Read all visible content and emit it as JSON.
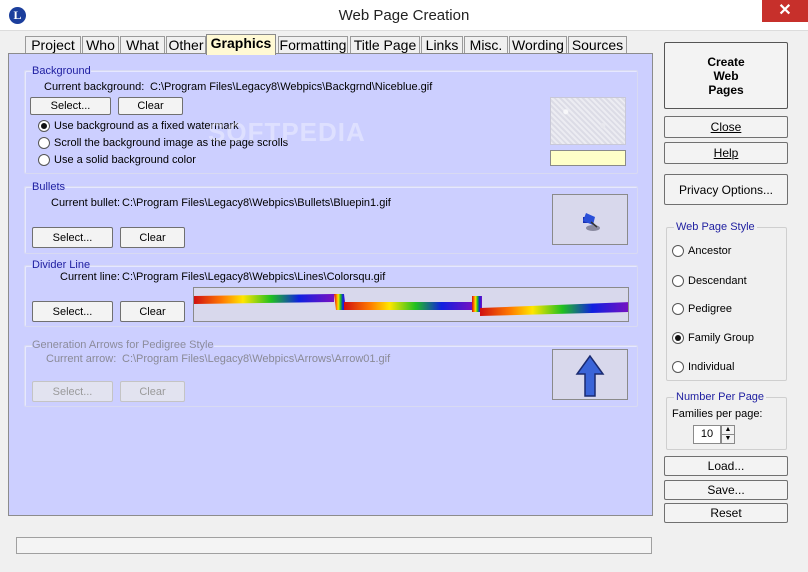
{
  "window": {
    "title": "Web Page Creation",
    "close_glyph": "✕",
    "app_icon_letter": "L"
  },
  "tabs": [
    "Project",
    "Who",
    "What",
    "Other",
    "Graphics",
    "Formatting",
    "Title Page",
    "Links",
    "Misc.",
    "Wording",
    "Sources"
  ],
  "active_tab": "Graphics",
  "background": {
    "label": "Background",
    "current_caption": "Current background:",
    "path": "C:\\Program Files\\Legacy8\\Webpics\\Backgrnd\\Niceblue.gif",
    "select_label": "Select...",
    "clear_label": "Clear",
    "options": [
      {
        "label": "Use background as a fixed watermark",
        "checked": true
      },
      {
        "label": "Scroll the background image as the page scrolls",
        "checked": false
      },
      {
        "label": "Use a solid background color",
        "checked": false
      }
    ],
    "swatch_color": "#ffffc8"
  },
  "bullets": {
    "label": "Bullets",
    "current_caption": "Current bullet:",
    "path": "C:\\Program Files\\Legacy8\\Webpics\\Bullets\\Bluepin1.gif",
    "select_label": "Select...",
    "clear_label": "Clear",
    "preview_icon": "pushpin-icon"
  },
  "divider": {
    "label": "Divider Line",
    "current_caption": "Current line:",
    "path": "C:\\Program Files\\Legacy8\\Webpics\\Lines\\Colorsqu.gif",
    "select_label": "Select...",
    "clear_label": "Clear"
  },
  "arrows": {
    "label": "Generation Arrows for Pedigree Style",
    "current_caption": "Current arrow:",
    "path": "C:\\Program Files\\Legacy8\\Webpics\\Arrows\\Arrow01.gif",
    "select_label": "Select...",
    "clear_label": "Clear",
    "preview_icon": "up-arrow-icon"
  },
  "watermark_text": "SOFTPEDIA",
  "right_panel": {
    "create_lines": [
      "Create",
      "Web",
      "Pages"
    ],
    "close_label": "Close",
    "help_label": "Help",
    "privacy_label": "Privacy Options...",
    "style_group_label": "Web Page Style",
    "styles": [
      {
        "label": "Ancestor",
        "checked": false
      },
      {
        "label": "Descendant",
        "checked": false
      },
      {
        "label": "Pedigree",
        "checked": false
      },
      {
        "label": "Family Group",
        "checked": true
      },
      {
        "label": "Individual",
        "checked": false
      }
    ],
    "number_group_label": "Number Per Page",
    "families_label": "Families per page:",
    "families_value": "10",
    "load_label": "Load...",
    "save_label": "Save...",
    "reset_label": "Reset"
  },
  "colors": {
    "panel_bg": "#cccfff",
    "active_tab_bg": "#fff9d4",
    "group_label": "#1e1ea0",
    "close_button": "#c7302b"
  }
}
